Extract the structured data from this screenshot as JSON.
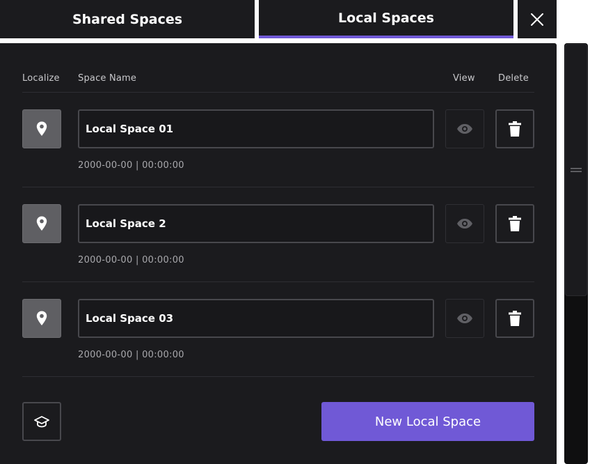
{
  "tabs": {
    "shared_label": "Shared Spaces",
    "local_label": "Local Spaces",
    "active": "Local Spaces"
  },
  "headers": {
    "localize": "Localize",
    "space_name": "Space Name",
    "view": "View",
    "delete": "Delete"
  },
  "spaces": [
    {
      "name": "Local Space 01",
      "timestamp": "2000-00-00 | 00:00:00"
    },
    {
      "name": "Local Space 2",
      "timestamp": "2000-00-00 | 00:00:00"
    },
    {
      "name": "Local Space 03",
      "timestamp": "2000-00-00 | 00:00:00"
    }
  ],
  "actions": {
    "new_space_label": "New Local Space"
  },
  "icons": {
    "close": "close-icon",
    "localize": "location-pin-icon",
    "view": "eye-icon",
    "delete": "trash-icon",
    "tutorial": "graduation-cap-icon",
    "scroll_handle": "drag-handle-icon"
  },
  "colors": {
    "accent": "#7059d6",
    "panel_bg": "#1b1b1e",
    "text": "#ffffff",
    "muted_text": "#a9a9ad"
  }
}
